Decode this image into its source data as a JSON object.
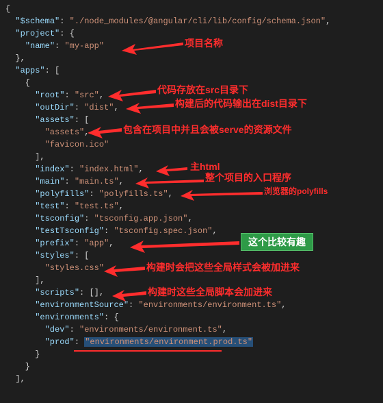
{
  "code": {
    "l1": "{",
    "l2_k": "\"$schema\"",
    "l2_v": "\"./node_modules/@angular/cli/lib/config/schema.json\"",
    "l3_k": "\"project\"",
    "l4_k": "\"name\"",
    "l4_v": "\"my-app\"",
    "l5": "  },",
    "l6_k": "\"apps\"",
    "l7": "    {",
    "l8_k": "\"root\"",
    "l8_v": "\"src\"",
    "l9_k": "\"outDir\"",
    "l9_v": "\"dist\"",
    "l10_k": "\"assets\"",
    "l11_v": "\"assets\"",
    "l12_v": "\"favicon.ico\"",
    "l13": "      ],",
    "l14_k": "\"index\"",
    "l14_v": "\"index.html\"",
    "l15_k": "\"main\"",
    "l15_v": "\"main.ts\"",
    "l16_k": "\"polyfills\"",
    "l16_v": "\"polyfills.ts\"",
    "l17_k": "\"test\"",
    "l17_v": "\"test.ts\"",
    "l18_k": "\"tsconfig\"",
    "l18_v": "\"tsconfig.app.json\"",
    "l19_k": "\"testTsconfig\"",
    "l19_v": "\"tsconfig.spec.json\"",
    "l20_k": "\"prefix\"",
    "l20_v": "\"app\"",
    "l21_k": "\"styles\"",
    "l22_v": "\"styles.css\"",
    "l23": "      ],",
    "l24_k": "\"scripts\"",
    "l24_v": "[]",
    "l25_k": "\"environmentSource\"",
    "l25_v": "\"environments/environment.ts\"",
    "l26_k": "\"environments\"",
    "l27_k": "\"dev\"",
    "l27_v": "\"environments/environment.ts\"",
    "l28_k": "\"prod\"",
    "l28_v": "\"environments/environment.prod.ts\"",
    "l29": "      }",
    "l30": "    }",
    "l31": "  ],"
  },
  "ann": {
    "a1": "项目名称",
    "a2": "代码存放在src目录下",
    "a3": "构建后的代码输出在dist目录下",
    "a4": "包含在项目中并且会被serve的资源文件",
    "a5": "主html",
    "a6": "整个项目的入口程序",
    "a7": "浏览器的polyfills",
    "a8": "这个比较有趣",
    "a9": "构建时会把这些全局样式会被加进来",
    "a10": "构建时这些全局脚本会加进来"
  }
}
